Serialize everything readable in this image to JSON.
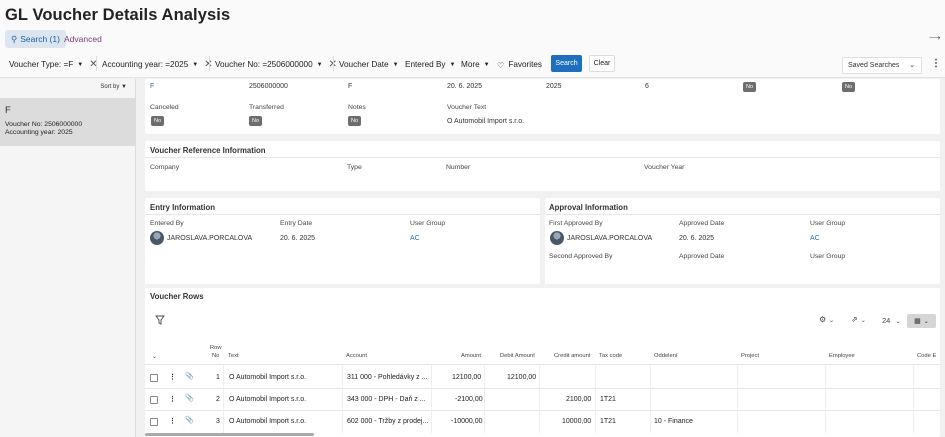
{
  "page": {
    "title": "GL Voucher Details Analysis"
  },
  "tabs": {
    "search": "Search (1)",
    "advanced": "Advanced"
  },
  "filters": {
    "voucher_type": "Voucher Type: =F",
    "accounting_year": "Accounting year: =2025",
    "voucher_no": "Voucher No: =2506000000",
    "voucher_date": "Voucher Date",
    "entered_by": "Entered By",
    "more": "More",
    "favorites": "Favorites",
    "search_btn": "Search",
    "clear_btn": "Clear",
    "saved_searches": "Saved Searches"
  },
  "left_panel": {
    "sort_by": "Sort by",
    "card": {
      "title": "F",
      "voucher_no": "Voucher No:  2506000000",
      "accounting_year": "Accounting year:  2025"
    }
  },
  "top_row": {
    "v1": "F",
    "v2": "2506000000",
    "v3": "F",
    "v4": "20. 6. 2025",
    "v5": "2025",
    "v6": "6",
    "b1": "No",
    "b2": "No"
  },
  "general": {
    "canceled_label": "Canceled",
    "canceled": "No",
    "transferred_label": "Transferred",
    "transferred": "No",
    "notes_label": "Notes",
    "notes": "No",
    "voucher_text_label": "Voucher Text",
    "voucher_text": "O Automobil Import s.r.o."
  },
  "reference": {
    "title": "Voucher Reference Information",
    "company": "Company",
    "type": "Type",
    "number": "Number",
    "voucher_year": "Voucher Year"
  },
  "entry": {
    "title": "Entry Information",
    "entered_by_label": "Entered By",
    "entered_by": "JAROSLAVA.PORCALOVA",
    "entry_date_label": "Entry Date",
    "entry_date": "20. 6. 2025",
    "user_group_label": "User Group",
    "user_group": "AC"
  },
  "approval": {
    "title": "Approval Information",
    "first_label": "First Approved By",
    "first": "JAROSLAVA.PORCALOVA",
    "approved_date_label": "Approved Date",
    "approved_date": "20. 6. 2025",
    "user_group_label": "User Group",
    "user_group": "AC",
    "second_label": "Second Approved By",
    "approved_date2_label": "Approved Date",
    "user_group2_label": "User Group"
  },
  "voucher_rows": {
    "title": "Voucher Rows",
    "page_size": "24",
    "columns": {
      "row_no_1": "Row",
      "row_no_2": "No",
      "text": "Text",
      "account": "Account",
      "amount": "Amount",
      "debit": "Debit Amount",
      "credit": "Credit amount",
      "tax": "Tax code",
      "oddeleni": "Oddelení",
      "project": "Project",
      "employee": "Employee",
      "code_e": "Code E"
    },
    "rows": [
      {
        "no": "1",
        "text": "O Automobil Import s.r.o.",
        "account": "311 000 - Pohledávky z ...",
        "amount": "12100,00",
        "debit": "12100,00",
        "credit": "",
        "tax": "",
        "oddeleni": ""
      },
      {
        "no": "2",
        "text": "O Automobil Import s.r.o.",
        "account": "343 000 - DPH -  Daň z ...",
        "amount": "-2100,00",
        "debit": "",
        "credit": "2100,00",
        "tax": "1T21",
        "oddeleni": ""
      },
      {
        "no": "3",
        "text": "O Automobil Import s.r.o.",
        "account": "602 000 - Tržby z prodej...",
        "amount": "-10000,00",
        "debit": "",
        "credit": "10000,00",
        "tax": "1T21",
        "oddeleni": "10 - Finance"
      }
    ]
  }
}
